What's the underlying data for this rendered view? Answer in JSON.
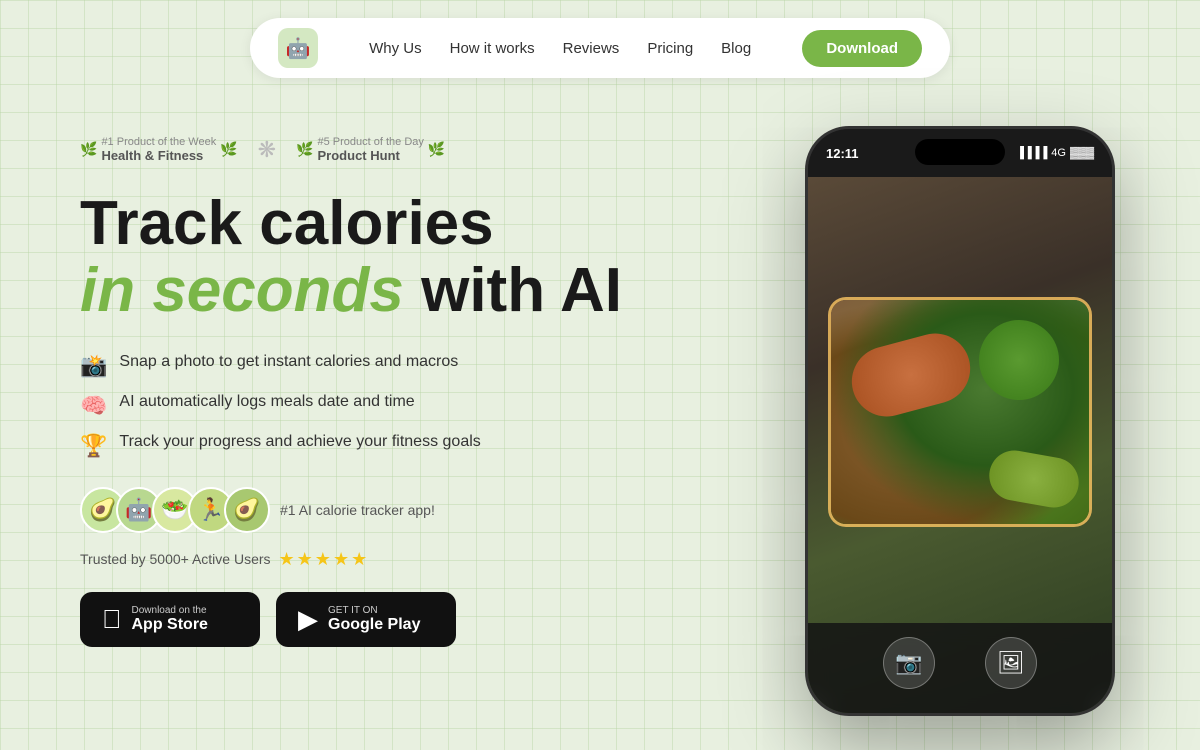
{
  "nav": {
    "logo_emoji": "🤖",
    "links": [
      {
        "label": "Why Us",
        "id": "why-us"
      },
      {
        "label": "How it works",
        "id": "how-it-works"
      },
      {
        "label": "Reviews",
        "id": "reviews"
      },
      {
        "label": "Pricing",
        "id": "pricing"
      },
      {
        "label": "Blog",
        "id": "blog"
      }
    ],
    "download_label": "Download"
  },
  "badges": [
    {
      "rank": "#1 Product of the Week",
      "name": "Health & Fitness"
    },
    {
      "rank": "#5 Product of the Day",
      "name": "Product Hunt"
    }
  ],
  "hero": {
    "line1": "Track calories",
    "line2_green": "in seconds",
    "line2_rest": " with AI"
  },
  "features": [
    {
      "emoji": "📸",
      "text": "Snap a photo to get instant calories and macros"
    },
    {
      "emoji": "🧠",
      "text": "AI automatically logs meals date and time"
    },
    {
      "emoji": "🏆",
      "text": "Track your progress and achieve your fitness goals"
    }
  ],
  "social_proof": {
    "avatars": [
      "🥑",
      "🤖",
      "🥗",
      "🏃",
      "🥑"
    ],
    "badge_text": "#1 AI calorie tracker app!"
  },
  "trusted": {
    "text": "Trusted by 5000+ Active Users",
    "stars": "★★★★★"
  },
  "store_buttons": [
    {
      "id": "app-store",
      "icon": "",
      "sub": "Download on the",
      "main": "App Store"
    },
    {
      "id": "google-play",
      "icon": "▶",
      "sub": "GET IT ON",
      "main": "Google Play"
    }
  ],
  "phone": {
    "time": "12:11",
    "signal": "4G"
  }
}
